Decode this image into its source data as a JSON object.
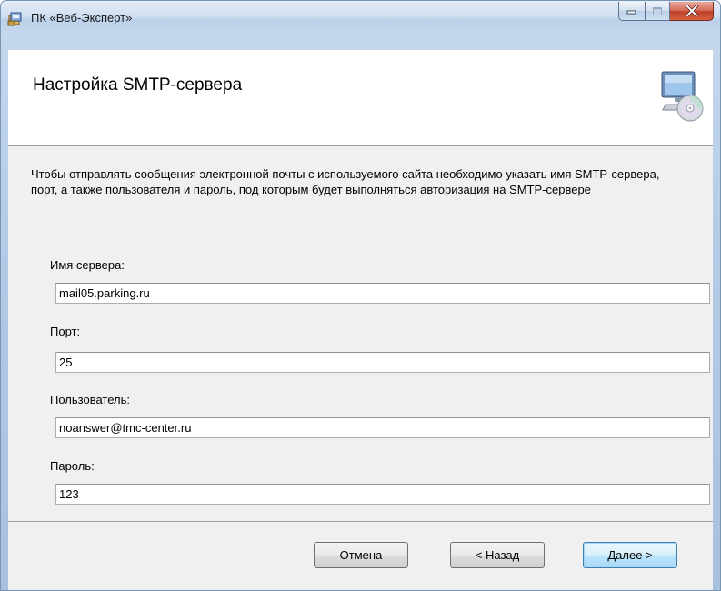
{
  "window": {
    "title": "ПК «Веб-Эксперт»"
  },
  "header": {
    "title": "Настройка SMTP-сервера"
  },
  "body": {
    "description": "Чтобы отправлять сообщения электронной почты с используемого сайта необходимо указать имя SMTP-сервера, порт, а также пользователя и пароль, под которым будет выполняться авторизация на SMTP-сервере"
  },
  "fields": {
    "server": {
      "label": "Имя сервера:",
      "value": "mail05.parking.ru"
    },
    "port": {
      "label": "Порт:",
      "value": "25"
    },
    "user": {
      "label": "Пользователь:",
      "value": "noanswer@tmc-center.ru"
    },
    "password": {
      "label": "Пароль:",
      "value": "123"
    }
  },
  "buttons": {
    "cancel": "Отмена",
    "back": "< Назад",
    "next_accel": "Д",
    "next_rest": "алее >"
  },
  "colors": {
    "title_bar": "#cfdff1",
    "close_button": "#c0412a",
    "default_button_border": "#3c7fb1",
    "panel_background": "#f0f0f0"
  },
  "icons": {
    "title": "installer-package-icon",
    "header": "computer-with-disc-icon",
    "minimize": "minimize-icon",
    "maximize": "maximize-icon",
    "close": "close-icon"
  }
}
